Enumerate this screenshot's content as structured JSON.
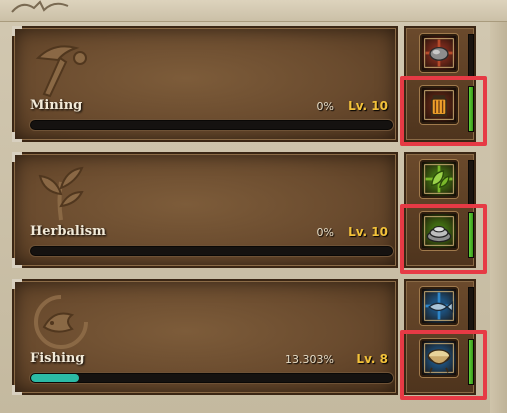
{
  "skills": [
    {
      "name": "Mining",
      "percent": "0%",
      "level": "Lv. 10",
      "progress": 0.0,
      "emblem": "pickaxe-emblem-icon",
      "upper_slot": {
        "icon": "ore-rock-icon",
        "bg": "#7a2a1c"
      },
      "lower_slot": {
        "icon": "lantern-icon",
        "bg": "#5a2414"
      },
      "lower_gauge_color": "#5fd23a"
    },
    {
      "name": "Herbalism",
      "percent": "0%",
      "level": "Lv. 10",
      "progress": 0.0,
      "emblem": "herb-emblem-icon",
      "upper_slot": {
        "icon": "leaf-icon",
        "bg": "#3f6a12"
      },
      "lower_slot": {
        "icon": "mortar-bowl-icon",
        "bg": "#3f6a12"
      },
      "lower_gauge_color": "#5fd23a"
    },
    {
      "name": "Fishing",
      "percent": "13.303%",
      "level": "Lv. 8",
      "progress": 0.13303,
      "emblem": "fish-emblem-icon",
      "upper_slot": {
        "icon": "fish-icon",
        "bg": "#1d4f7a"
      },
      "lower_slot": {
        "icon": "bait-bowl-icon",
        "bg": "#1d4f7a"
      },
      "lower_gauge_color": "#5fd23a"
    }
  ],
  "colors": {
    "highlight": "#e63a45",
    "level_text": "#f3c23a",
    "xp_fill": "#2bbba6"
  }
}
